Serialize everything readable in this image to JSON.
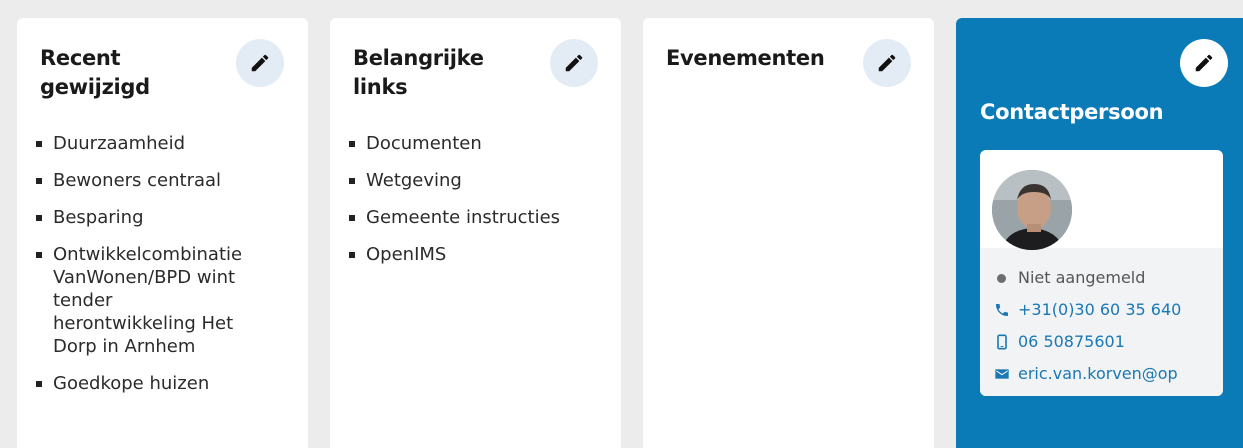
{
  "cards": {
    "recent": {
      "title_line1": "Recent",
      "title_line2": "gewijzigd",
      "items": [
        "Duurzaamheid",
        "Bewoners centraal",
        "Besparing",
        "Ontwikkelcombinatie VanWonen/BPD wint tender herontwikkeling Het Dorp in Arnhem",
        "Goedkope huizen"
      ]
    },
    "links": {
      "title_line1": "Belangrijke",
      "title_line2": "links",
      "items": [
        "Documenten",
        "Wetgeving",
        "Gemeente instructies",
        "OpenIMS"
      ]
    },
    "events": {
      "title": "Evenementen"
    },
    "contact": {
      "title": "Contactpersoon",
      "status": "Niet aangemeld",
      "phone": "+31(0)30 60 35 640",
      "mobile": "06 50875601",
      "email": "eric.van.korven@op"
    }
  },
  "icons": {
    "edit": "pencil-icon",
    "phone": "phone-icon",
    "mobile": "mobile-icon",
    "email": "envelope-icon",
    "status": "status-dot-icon"
  },
  "colors": {
    "contact_bg": "#0a7bb7",
    "link_blue": "#1a78b5",
    "edit_bg": "#e3ecf5"
  }
}
